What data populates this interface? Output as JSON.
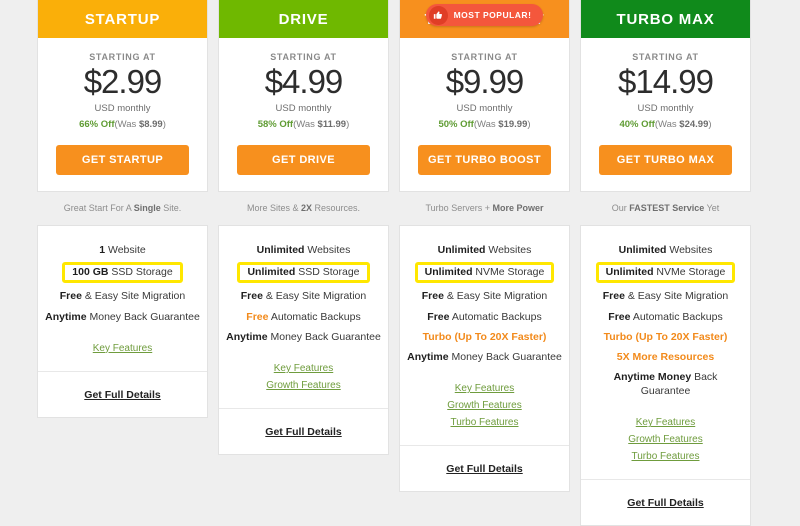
{
  "page": {
    "background": "#efefef",
    "accent_orange": "#f7901e",
    "highlight_yellow": "#ffe700",
    "link_green": "#6f9c3d",
    "discount_green": "#5f9c33"
  },
  "badge": {
    "label": "MOST POPULAR!",
    "icon": "thumbs-up-icon",
    "glyph": "👍",
    "pill_color": "#f4573c",
    "circle_color": "#e03e26"
  },
  "labels": {
    "starting_at": "STARTING AT",
    "usd_monthly": "USD monthly",
    "key_features": "Key Features",
    "growth_features": "Growth Features",
    "turbo_features": "Turbo Features",
    "get_full_details": "Get Full Details"
  },
  "plans": [
    {
      "name": "STARTUP",
      "header_color": "#faaf09",
      "price": "$2.99",
      "discount_pct": "66% Off",
      "was_prefix": "(Was ",
      "was_amount": "$8.99",
      "was_suffix": ")",
      "cta": "GET STARTUP",
      "tagline_pre": "Great Start For A ",
      "tagline_bold": "Single",
      "tagline_post": " Site.",
      "popular": false,
      "features": [
        {
          "bold": "1",
          "rest": " Website",
          "highlight": false,
          "orange": false
        },
        {
          "bold": "100 GB",
          "rest": " SSD Storage",
          "highlight": true,
          "orange": false
        },
        {
          "bold": "Free",
          "rest": " & Easy Site Migration",
          "highlight": false,
          "orange": false
        },
        {
          "bold": "Anytime",
          "rest": " Money Back Guarantee",
          "highlight": false,
          "orange": false
        }
      ],
      "links": [
        "Key Features"
      ]
    },
    {
      "name": "DRIVE",
      "header_color": "#6fb800",
      "price": "$4.99",
      "discount_pct": "58% Off",
      "was_prefix": "(Was ",
      "was_amount": "$11.99",
      "was_suffix": ")",
      "cta": "GET DRIVE",
      "tagline_pre": "More Sites & ",
      "tagline_bold": "2X",
      "tagline_post": " Resources.",
      "popular": false,
      "features": [
        {
          "bold": "Unlimited",
          "rest": " Websites",
          "highlight": false,
          "orange": false
        },
        {
          "bold": "Unlimited",
          "rest": " SSD Storage",
          "highlight": true,
          "orange": false
        },
        {
          "bold": "Free",
          "rest": " & Easy Site Migration",
          "highlight": false,
          "orange": false
        },
        {
          "bold": "Free",
          "rest": " Automatic Backups",
          "highlight": false,
          "orange": "word"
        },
        {
          "bold": "Anytime",
          "rest": " Money Back Guarantee",
          "highlight": false,
          "orange": false
        }
      ],
      "links": [
        "Key Features",
        "Growth Features"
      ]
    },
    {
      "name": "TURBO BOOST",
      "header_color": "#f7901e",
      "price": "$9.99",
      "discount_pct": "50% Off",
      "was_prefix": "(Was ",
      "was_amount": "$19.99",
      "was_suffix": ")",
      "cta": "GET TURBO BOOST",
      "tagline_pre": "Turbo Servers + ",
      "tagline_bold": "More Power",
      "tagline_post": "",
      "popular": true,
      "features": [
        {
          "bold": "Unlimited",
          "rest": " Websites",
          "highlight": false,
          "orange": false
        },
        {
          "bold": "Unlimited",
          "rest": " NVMe Storage",
          "highlight": true,
          "orange": false
        },
        {
          "bold": "Free",
          "rest": " & Easy Site Migration",
          "highlight": false,
          "orange": false
        },
        {
          "bold": "Free",
          "rest": " Automatic Backups",
          "highlight": false,
          "orange": false
        },
        {
          "bold": "Turbo (Up To 20X Faster)",
          "rest": "",
          "highlight": false,
          "orange": "all"
        },
        {
          "bold": "Anytime",
          "rest": " Money Back Guarantee",
          "highlight": false,
          "orange": false
        }
      ],
      "links": [
        "Key Features",
        "Growth Features",
        "Turbo Features"
      ]
    },
    {
      "name": "TURBO MAX",
      "header_color": "#108a1b",
      "price": "$14.99",
      "discount_pct": "40% Off",
      "was_prefix": "(Was ",
      "was_amount": "$24.99",
      "was_suffix": ")",
      "cta": "GET TURBO MAX",
      "tagline_pre": "Our ",
      "tagline_bold": "FASTEST Service",
      "tagline_post": " Yet",
      "popular": false,
      "features": [
        {
          "bold": "Unlimited",
          "rest": " Websites",
          "highlight": false,
          "orange": false
        },
        {
          "bold": "Unlimited",
          "rest": " NVMe Storage",
          "highlight": true,
          "orange": false
        },
        {
          "bold": "Free",
          "rest": " & Easy Site Migration",
          "highlight": false,
          "orange": false
        },
        {
          "bold": "Free",
          "rest": " Automatic Backups",
          "highlight": false,
          "orange": false
        },
        {
          "bold": "Turbo (Up To 20X Faster)",
          "rest": "",
          "highlight": false,
          "orange": "all"
        },
        {
          "bold": "5X More Resources",
          "rest": "",
          "highlight": false,
          "orange": "all"
        },
        {
          "bold": "Anytime Money",
          "rest": " Back Guarantee",
          "highlight": false,
          "orange": false
        }
      ],
      "links": [
        "Key Features",
        "Growth Features",
        "Turbo Features"
      ]
    }
  ]
}
